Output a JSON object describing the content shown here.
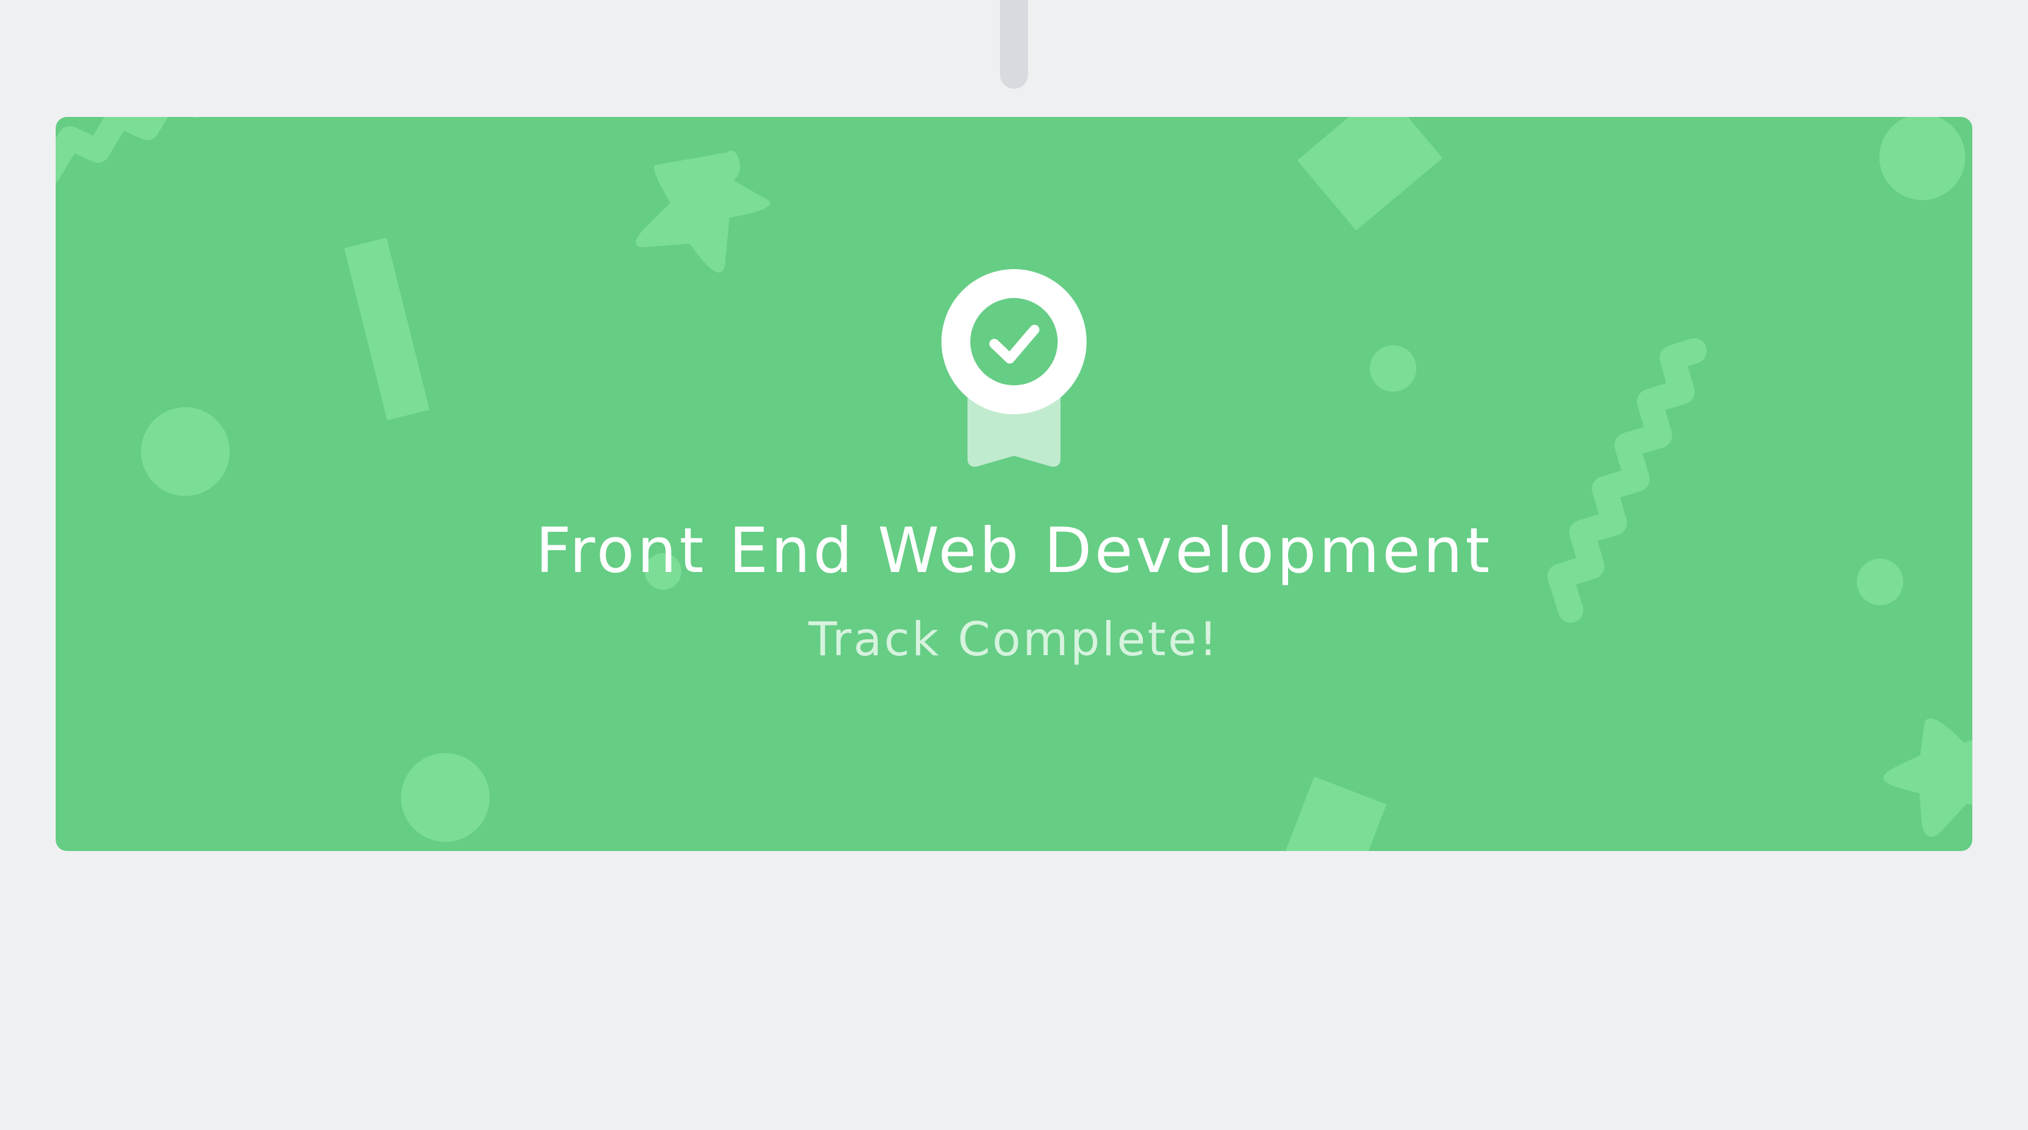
{
  "completion_card": {
    "title": "Front End Web Development",
    "subtitle": "Track Complete!",
    "badge_icon": "award-ribbon-checkmark-icon"
  },
  "colors": {
    "page_background": "#eff0f2",
    "card_background": "#65cd84",
    "confetti": "#7cdd96",
    "connector": "#d7dbdf",
    "title_text": "#ffffff",
    "subtitle_text": "#d6f3de",
    "ribbon": "#c1ebce"
  }
}
